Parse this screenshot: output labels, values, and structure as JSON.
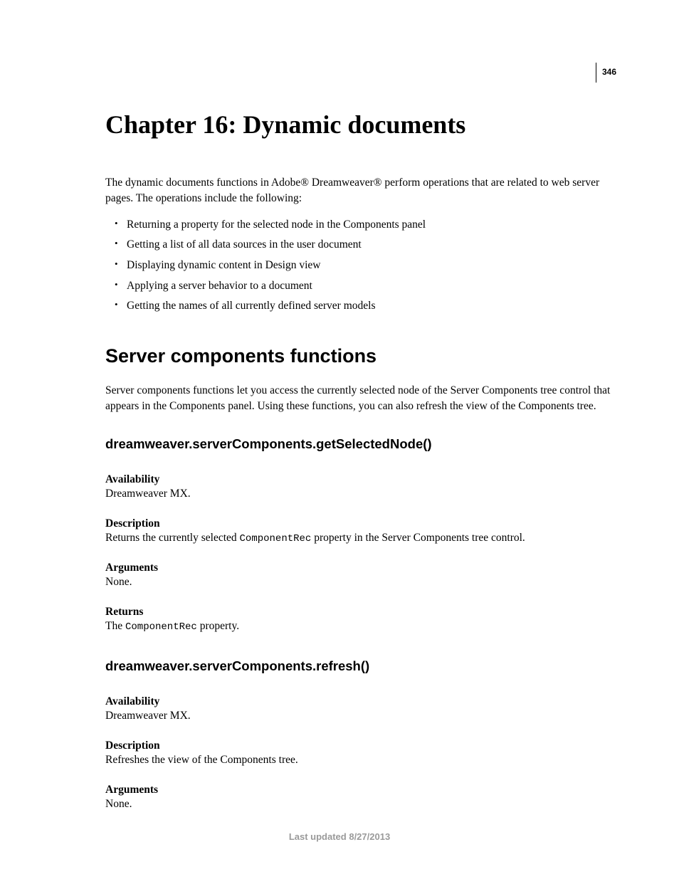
{
  "page_number": "346",
  "chapter_title": "Chapter 16: Dynamic documents",
  "intro": "The dynamic documents functions in Adobe® Dreamweaver® perform operations that are related to web server pages. The operations include the following:",
  "bullets": [
    "Returning a property for the selected node in the Components panel",
    "Getting a list of all data sources in the user document",
    "Displaying dynamic content in Design view",
    "Applying a server behavior to a document",
    "Getting the names of all currently defined server models"
  ],
  "section_title": "Server components functions",
  "section_intro": "Server components functions let you access the currently selected node of the Server Components tree control that appears in the Components panel. Using these functions, you can also refresh the view of the Components tree.",
  "api1": {
    "name": "dreamweaver.serverComponents.getSelectedNode()",
    "availability_label": "Availability",
    "availability_value": "Dreamweaver MX.",
    "description_label": "Description",
    "description_pre": "Returns the currently selected ",
    "description_code": "ComponentRec",
    "description_post": " property in the Server Components tree control.",
    "arguments_label": "Arguments",
    "arguments_value": "None.",
    "returns_label": "Returns",
    "returns_pre": "The ",
    "returns_code": "ComponentRec",
    "returns_post": " property."
  },
  "api2": {
    "name": "dreamweaver.serverComponents.refresh()",
    "availability_label": "Availability",
    "availability_value": "Dreamweaver MX.",
    "description_label": "Description",
    "description_value": "Refreshes the view of the Components tree.",
    "arguments_label": "Arguments",
    "arguments_value": "None."
  },
  "footer": "Last updated 8/27/2013"
}
